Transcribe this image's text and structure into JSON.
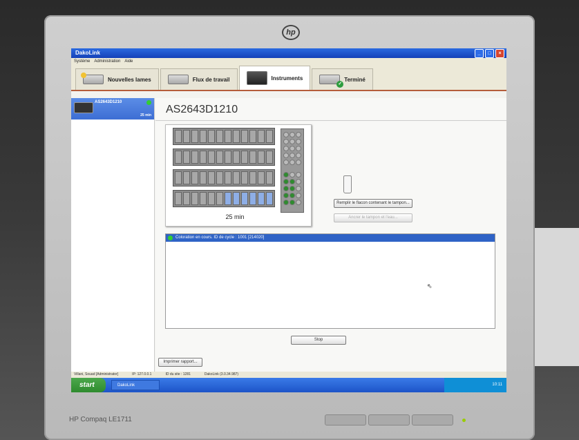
{
  "app": {
    "title": "DakoLink",
    "menu": [
      "Système",
      "Administration",
      "Aide"
    ]
  },
  "tabs": [
    {
      "label": "Nouvelles lames"
    },
    {
      "label": "Flux de travail"
    },
    {
      "label": "Instruments"
    },
    {
      "label": "Terminé"
    }
  ],
  "sidebar": {
    "instrument_id": "AS2643D1210",
    "time": "25 min"
  },
  "main": {
    "instrument_title": "AS2643D1210",
    "instrument_time": "25 min",
    "fill_button": "Remplir le flacon contenant le tampon...",
    "disabled_button": "Ancrer le tampon et l'eau...",
    "log_entry": "Coloration en cours. ID de cycle : 1001 [214020]",
    "stop_button": "Stop",
    "print_button": "Imprimer rapport..."
  },
  "statusbar": {
    "user": "Villani, Souad [Administrator]",
    "ip": "IP: 127.0.0.1",
    "site": "ID du site : 1281",
    "version": "DakoLink (3.0.34.987)"
  },
  "taskbar": {
    "start_label": "start",
    "task_label": "DakoLink",
    "clock": "10:11"
  },
  "monitor": {
    "logo": "hp",
    "brand": "HP Compaq LE1711"
  },
  "colors": {
    "accent": "#2f63c6",
    "status_ok": "#33cc33",
    "tab_underline": "#b55d3a"
  }
}
